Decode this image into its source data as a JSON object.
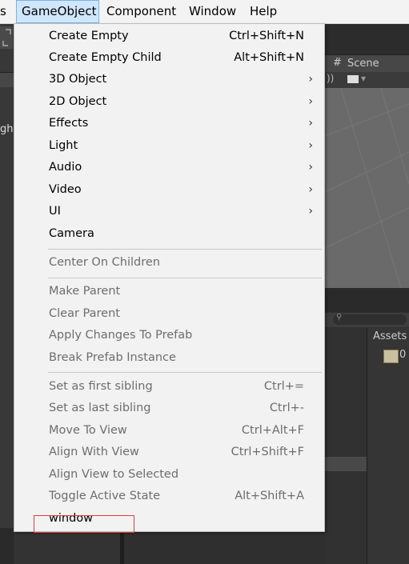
{
  "menubar": {
    "items": [
      {
        "label": "s"
      },
      {
        "label": "GameObject"
      },
      {
        "label": "Component"
      },
      {
        "label": "Window"
      },
      {
        "label": "Help"
      }
    ]
  },
  "scene": {
    "tab_label": "Scene",
    "assets_label": "Assets",
    "asset_count": "0",
    "partial_left_label": "ght"
  },
  "gameobject_menu": {
    "items": [
      {
        "label": "Create Empty",
        "shortcut": "Ctrl+Shift+N",
        "enabled": true
      },
      {
        "label": "Create Empty Child",
        "shortcut": "Alt+Shift+N",
        "enabled": true
      },
      {
        "label": "3D Object",
        "submenu": true,
        "enabled": true
      },
      {
        "label": "2D Object",
        "submenu": true,
        "enabled": true
      },
      {
        "label": "Effects",
        "submenu": true,
        "enabled": true
      },
      {
        "label": "Light",
        "submenu": true,
        "enabled": true
      },
      {
        "label": "Audio",
        "submenu": true,
        "enabled": true
      },
      {
        "label": "Video",
        "submenu": true,
        "enabled": true
      },
      {
        "label": "UI",
        "submenu": true,
        "enabled": true
      },
      {
        "label": "Camera",
        "enabled": true
      },
      {
        "label": "Center On Children",
        "enabled": false
      },
      {
        "label": "Make Parent",
        "enabled": false
      },
      {
        "label": "Clear Parent",
        "enabled": false
      },
      {
        "label": "Apply Changes To Prefab",
        "enabled": false
      },
      {
        "label": "Break Prefab Instance",
        "enabled": false
      },
      {
        "label": "Set as first sibling",
        "shortcut": "Ctrl+=",
        "enabled": false
      },
      {
        "label": "Set as last sibling",
        "shortcut": "Ctrl+-",
        "enabled": false
      },
      {
        "label": "Move To View",
        "shortcut": "Ctrl+Alt+F",
        "enabled": false
      },
      {
        "label": "Align With View",
        "shortcut": "Ctrl+Shift+F",
        "enabled": false
      },
      {
        "label": "Align View to Selected",
        "enabled": false
      },
      {
        "label": "Toggle Active State",
        "shortcut": "Alt+Shift+A",
        "enabled": false
      },
      {
        "label": "window",
        "enabled": true,
        "highlighted": true
      }
    ],
    "submenu_arrow": "›",
    "highlight_color": "#e23b3b"
  }
}
